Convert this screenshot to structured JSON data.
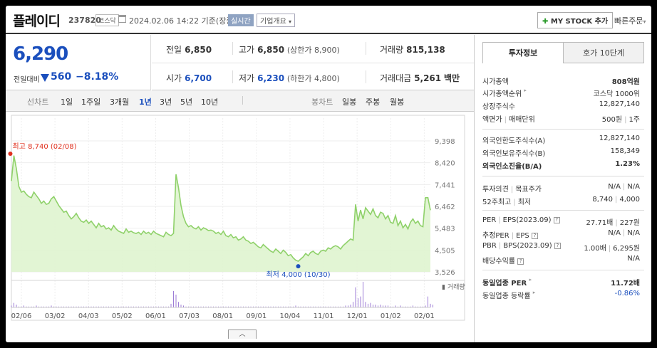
{
  "header": {
    "stock_name": "플레이디",
    "stock_code": "237820",
    "market": "코스닥",
    "datetime": "2024.02.06 14:22 기준(장중)",
    "realtime_badge": "실시간",
    "company_info_label": "기업개요",
    "company_info_caret": "▾",
    "my_stock_plus": "✚",
    "my_stock_label": "MY STOCK 추가",
    "quick_order_label": "빠른주문",
    "quick_order_caret": "▾"
  },
  "price": {
    "current": "6,290",
    "change_label": "전일대비",
    "change": "560",
    "change_rate": "−8.18%",
    "direction": "down",
    "color": "#1b4fbd"
  },
  "quote": {
    "prev_close_label": "전일",
    "prev_close": "6,850",
    "high_label": "고가",
    "high": "6,850",
    "upper_limit_label": "(상한가",
    "upper_limit": "8,900",
    "upper_limit_close": ")",
    "volume_label": "거래량",
    "volume": "815,138",
    "open_label": "시가",
    "open": "6,700",
    "low_label": "저가",
    "low": "6,230",
    "lower_limit_label": "(하한가",
    "lower_limit": "4,800",
    "lower_limit_close": ")",
    "trade_value_label": "거래대금",
    "trade_value": "5,261",
    "trade_value_unit": "백만"
  },
  "period_bar": {
    "line_label": "선차트",
    "periods": [
      "1일",
      "1주일",
      "3개월",
      "1년",
      "3년",
      "5년",
      "10년"
    ],
    "selected": "1년",
    "candle_label": "봉차트",
    "candles": [
      "일봉",
      "주봉",
      "월봉"
    ]
  },
  "chart_data": {
    "type": "area",
    "x_ticks": [
      "02/06",
      "03/02",
      "04/03",
      "05/02",
      "06/01",
      "07/03",
      "08/01",
      "09/01",
      "10/04",
      "11/01",
      "12/01",
      "01/02",
      "02/01"
    ],
    "y_ticks": [
      9398,
      8420,
      7441,
      6462,
      5483,
      4505,
      3526
    ],
    "y_tick_labels": [
      "9,398",
      "8,420",
      "7,441",
      "6,462",
      "5,483",
      "4,505",
      "3,526"
    ],
    "ylim": [
      3526,
      9398
    ],
    "grid": true,
    "max_annotation": "최고 8,740 (02/08)",
    "min_annotation": "최저 4,000 (10/30)",
    "volume_label": "거래량",
    "line_color": "#8fd16a",
    "fill_color": "#dff4cf",
    "series": [
      {
        "values": [
          7600,
          8740,
          8150,
          7350,
          7100,
          7150,
          7000,
          6900,
          6850,
          7100,
          6950,
          6800,
          6600,
          6700,
          6550,
          6600,
          6800,
          6900,
          6700,
          6500,
          6350,
          6200,
          6250,
          6050,
          5900,
          6000,
          6150,
          5950,
          5800,
          5750,
          5850,
          5700,
          5800,
          5650,
          5500,
          5700,
          5550,
          5600,
          5450,
          5500,
          5400,
          5600,
          5450,
          5350,
          5300,
          5250,
          5450,
          5300,
          5350,
          5280,
          5250,
          5300,
          5200,
          5350,
          5250,
          5300,
          5200,
          5350,
          5250,
          5200,
          5150,
          5100,
          5300,
          5200,
          5150,
          5250,
          7900,
          7300,
          6500,
          6000,
          5700,
          5550,
          5600,
          5500,
          5450,
          5550,
          5400,
          5500,
          5450,
          5380,
          5400,
          5350,
          5250,
          5300,
          5200,
          5350,
          5150,
          5100,
          5200,
          5050,
          5100,
          4950,
          5000,
          5100,
          4950,
          4900,
          4800,
          4850,
          4750,
          4650,
          4600,
          4750,
          4650,
          4550,
          4450,
          4400,
          4550,
          4450,
          4350,
          4500,
          4400,
          4250,
          4300,
          4150,
          4050,
          4000,
          4100,
          4200,
          4350,
          4250,
          4400,
          4450,
          4350,
          4300,
          4450,
          4500,
          4450,
          4600,
          4550,
          4650,
          4700,
          4650,
          4550,
          4700,
          4800,
          4900,
          5000,
          4950,
          6550,
          5800,
          6300,
          5900,
          6400,
          6250,
          6100,
          6350,
          6050,
          5950,
          6200,
          6150,
          5900,
          6050,
          5750,
          5700,
          6050,
          5600,
          5800,
          5500,
          5650,
          5450,
          5750,
          5900,
          5700,
          5800,
          5600,
          5550,
          6850,
          6850,
          6290
        ]
      }
    ],
    "volume": [
      2,
      5,
      3,
      1,
      1,
      2,
      1,
      1,
      1,
      1,
      2,
      1,
      1,
      1,
      1,
      1,
      2,
      1,
      1,
      1,
      1,
      1,
      1,
      1,
      1,
      1,
      1,
      1,
      1,
      1,
      1,
      1,
      1,
      1,
      1,
      1,
      1,
      1,
      1,
      1,
      1,
      1,
      1,
      1,
      1,
      1,
      1,
      1,
      1,
      1,
      1,
      1,
      1,
      1,
      1,
      1,
      1,
      1,
      1,
      1,
      1,
      1,
      1,
      1,
      4,
      18,
      14,
      6,
      3,
      2,
      1,
      1,
      1,
      1,
      1,
      1,
      1,
      1,
      1,
      1,
      1,
      1,
      1,
      1,
      1,
      1,
      1,
      1,
      1,
      1,
      1,
      1,
      1,
      1,
      1,
      1,
      1,
      1,
      1,
      1,
      1,
      1,
      1,
      1,
      1,
      1,
      1,
      1,
      1,
      1,
      1,
      1,
      1,
      1,
      2,
      1,
      1,
      1,
      1,
      1,
      1,
      1,
      1,
      1,
      1,
      1,
      1,
      1,
      1,
      1,
      1,
      1,
      1,
      1,
      2,
      2,
      3,
      6,
      22,
      10,
      12,
      28,
      6,
      4,
      5,
      3,
      3,
      2,
      3,
      2,
      2,
      2,
      1,
      1,
      2,
      1,
      2,
      1,
      1,
      1,
      1,
      2,
      1,
      1,
      1,
      1,
      2,
      12,
      4,
      3
    ]
  },
  "right_panel": {
    "tabs": [
      "투자정보",
      "호가 10단계"
    ],
    "selected_tab": "투자정보",
    "market_cap": {
      "label": "시가총액",
      "value": "808억원"
    },
    "market_cap_rank": {
      "label": "시가총액순위",
      "value": "코스닥 1000위"
    },
    "shares": {
      "label": "상장주식수",
      "value": "12,827,140"
    },
    "par_label": "액면가",
    "trade_unit_label": "매매단위",
    "par_value": "500원",
    "trade_unit": "1주",
    "foreign_limit": {
      "label": "외국인한도주식수(A)",
      "value": "12,827,140"
    },
    "foreign_hold": {
      "label": "외국인보유주식수(B)",
      "value": "158,349"
    },
    "foreign_rate": {
      "label": "외국인소진율(B/A)",
      "value": "1.23%"
    },
    "opinion_label": "투자의견",
    "target_label": "목표주가",
    "opinion": "N/A",
    "target": "N/A",
    "w52_high_label": "52주최고",
    "w52_low_label": "최저",
    "w52_high": "8,740",
    "w52_low": "4,000",
    "per_label": "PER",
    "eps_label": "EPS(2023.09)",
    "per": "27.71배",
    "eps": "227원",
    "est_per_label": "추정PER",
    "est_eps_label": "EPS",
    "est_per": "N/A",
    "est_eps": "N/A",
    "pbr_label": "PBR",
    "bps_label": "BPS(2023.09)",
    "pbr": "1.00배",
    "bps": "6,295원",
    "dividend_label": "배당수익률",
    "dividend": "N/A",
    "sector_per": {
      "label": "동일업종 PER",
      "value": "11.72배"
    },
    "sector_change": {
      "label": "동일업종 등락률",
      "value": "-0.86%"
    },
    "help_mark": "?",
    "more_mark": "▸",
    "separator": "|"
  }
}
